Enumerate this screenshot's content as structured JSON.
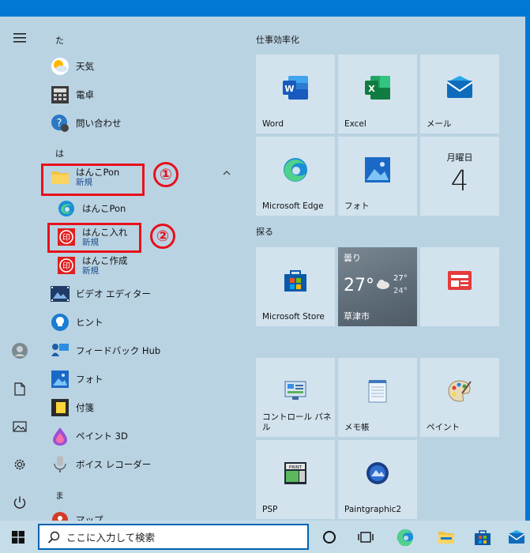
{
  "rail": {
    "menu_icon": "hamburger-icon",
    "items": [
      "user-avatar-icon",
      "document-icon",
      "pictures-icon",
      "settings-icon",
      "power-icon"
    ]
  },
  "applist": {
    "letters": {
      "ta": "た",
      "ha": "は",
      "ma": "ま"
    },
    "apps": {
      "weather": {
        "label": "天気"
      },
      "calculator": {
        "label": "電卓"
      },
      "contact": {
        "label": "問い合わせ"
      },
      "hanko_folder": {
        "label": "はんこPon",
        "sub": "新規"
      },
      "hanko_pon": {
        "label": "はんこPon"
      },
      "hanko_ire": {
        "label": "はんこ入れ",
        "sub": "新規"
      },
      "hanko_sakusei": {
        "label": "はんこ作成",
        "sub": "新規"
      },
      "video_editor": {
        "label": "ビデオ エディター"
      },
      "tips": {
        "label": "ヒント"
      },
      "feedback": {
        "label": "フィードバック Hub"
      },
      "photos": {
        "label": "フォト"
      },
      "sticky": {
        "label": "付箋"
      },
      "paint3d": {
        "label": "ペイント 3D"
      },
      "recorder": {
        "label": "ボイス レコーダー"
      },
      "maps": {
        "label": "マップ"
      }
    }
  },
  "annotations": {
    "one": "①",
    "two": "②"
  },
  "tiles": {
    "group1": "仕事効率化",
    "group2": "探る",
    "word": "Word",
    "excel": "Excel",
    "mail": "メール",
    "calendar": {
      "day": "月曜日",
      "date": "4"
    },
    "edge": "Microsoft Edge",
    "photos": "フォト",
    "store": "Microsoft Store",
    "weather": {
      "cond": "曇り",
      "temp": "27°",
      "high": "27°",
      "low": "24°",
      "city": "草津市"
    },
    "control_panel": "コントロール パネル",
    "notepad": "メモ帳",
    "paint": "ペイント",
    "psp": "PSP",
    "paintgraphic": "Paintgraphic2"
  },
  "taskbar": {
    "search_placeholder": "ここに入力して検索",
    "icons": [
      "windows-start-icon",
      "cortana-icon",
      "task-view-icon",
      "edge-icon",
      "file-explorer-icon",
      "store-icon",
      "mail-icon"
    ]
  },
  "colors": {
    "accent": "#0078d4",
    "annotation_red": "#e8101b",
    "menu_bg": "#b9d3e3",
    "tile_bg": "#d2e3ee"
  }
}
